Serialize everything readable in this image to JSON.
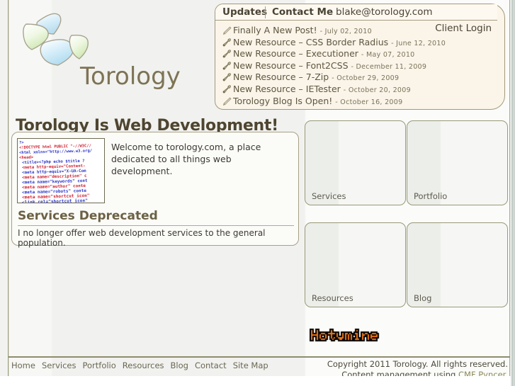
{
  "brand": {
    "name": "Torology",
    "logo_icon": "four-petal-logo",
    "petal_colors": [
      "#cfe7f3",
      "#e6f2d9",
      "#d2eaf6",
      "#dcefcf"
    ]
  },
  "header": {
    "nav": [
      {
        "label": "Updates",
        "name": "updates"
      },
      {
        "label": "Contact Me",
        "name": "contact-me"
      },
      {
        "label": "blake@torology.com",
        "name": "email"
      }
    ],
    "client_login": "Client Login"
  },
  "updates": [
    {
      "icon": "pencil-icon",
      "title": "Finally A New Post!",
      "date": "- July 02, 2010"
    },
    {
      "icon": "wrench-icon",
      "title": "New Resource – CSS Border Radius",
      "date": "- June 12, 2010"
    },
    {
      "icon": "wrench-icon",
      "title": "New Resource – Executioner",
      "date": "- May 07, 2010"
    },
    {
      "icon": "wrench-icon",
      "title": "New Resource – Font2CSS",
      "date": "- December 11, 2009"
    },
    {
      "icon": "wrench-icon",
      "title": "New Resource – 7-Zip",
      "date": "- October 29, 2009"
    },
    {
      "icon": "wrench-icon",
      "title": "New Resource – IETester",
      "date": "- October 20, 2009"
    },
    {
      "icon": "pencil-icon",
      "title": "Torology Blog Is Open!",
      "date": "- October 16, 2009"
    }
  ],
  "main": {
    "headline": "Torology Is Web Development!",
    "code_thumbnail_alt": "html-source-code-thumbnail",
    "code_lines": [
      "?>",
      "<!DOCTYPE html PUBLIC \"-//W3C//",
      "<html xmlns=\"http://www.w3.org/",
      "<head>",
      "    <title><?php echo $title ?",
      "    <meta http-equiv=\"Content-",
      "    <meta http-equiv=\"X-UA-Com",
      "    <meta name=\"description\" c",
      "    <meta name=\"keywords\" cont",
      "    <meta name=\"author\" conte",
      "    <meta name=\"robots\" conte",
      "    <meta name=\"shortcut icon\"",
      "    <link rel=\"shortcut icon\""
    ],
    "welcome": "Welcome to torology.com, a place dedicated to all things web development.",
    "section_heading": "Services Deprecated",
    "section_text": "I no longer offer web development services to the general population."
  },
  "feature_boxes": [
    {
      "label": "Services"
    },
    {
      "label": "Portfolio"
    },
    {
      "label": "Resources"
    },
    {
      "label": "Blog"
    }
  ],
  "badge": {
    "text": "Hotymine",
    "color": "#f07818",
    "outline": "#000000",
    "style": "pixel-font"
  },
  "footer": {
    "nav": [
      "Home",
      "Services",
      "Portfolio",
      "Resources",
      "Blog",
      "Contact",
      "Site Map"
    ],
    "copyright": "Copyright 2011 Torology. All rights reserved.",
    "cms_prefix": "Content management using ",
    "cms_link": "CMF Pyncer",
    "cms_suffix": "."
  },
  "colors": {
    "ink": "#4f4530",
    "rule": "#8e8c6e",
    "panel_bg": "#faf4e9",
    "panel_border": "#a29a7c",
    "box_border": "#9a9878"
  }
}
